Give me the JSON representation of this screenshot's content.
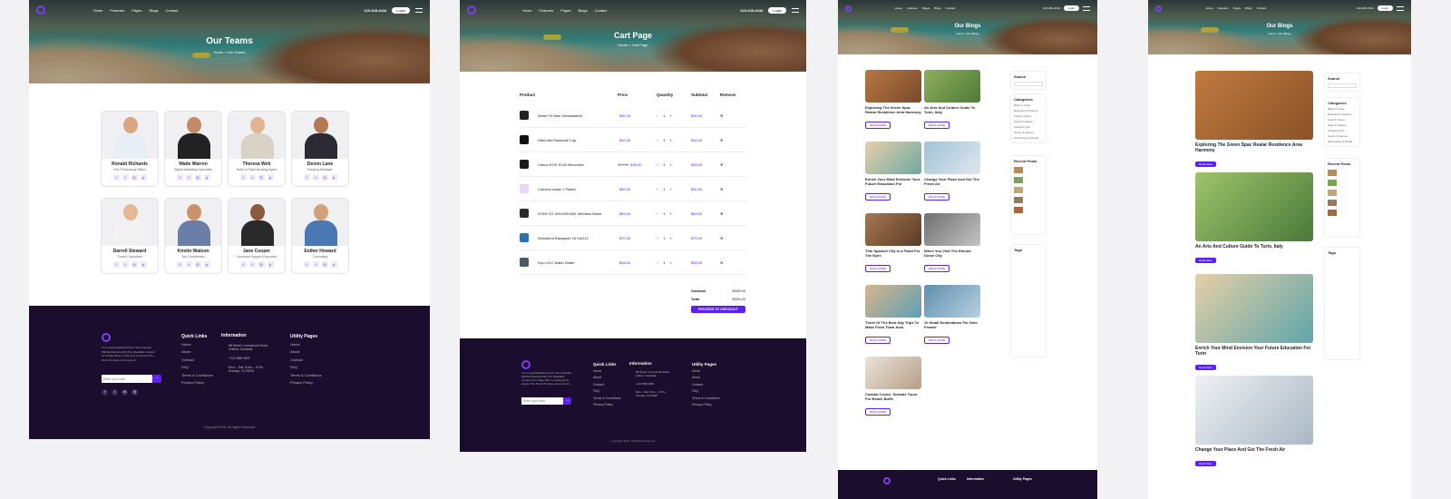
{
  "nav": {
    "links": [
      "Home",
      "Features",
      "Pages",
      "Blogs",
      "Contact"
    ],
    "call_label": "Call Us",
    "phone": "123-345-4444",
    "login": "Login"
  },
  "team_page": {
    "title": "Our Teams",
    "breadcrumb": "Home > Our Teams",
    "members": [
      {
        "name": "Ronald Richards",
        "role": "Vice Processing Officer"
      },
      {
        "name": "Wade Warren",
        "role": "Digital Marketing Specialist"
      },
      {
        "name": "Theresa Web",
        "role": "Hotel & Flight Booking Agent"
      },
      {
        "name": "Devon Lane",
        "role": "Booking Manager"
      },
      {
        "name": "Darrell Steward",
        "role": "Travel Consultant"
      },
      {
        "name": "Kristin Watson",
        "role": "Tour Coordinator"
      },
      {
        "name": "Jane Cooper",
        "role": "Customer Support Executive"
      },
      {
        "name": "Esther Howard",
        "role": "Consulting"
      }
    ]
  },
  "cart_page": {
    "title": "Cart Page",
    "breadcrumb": "Home > Cart Page",
    "columns": [
      "Product",
      "Price",
      "Quantity",
      "Subtotal",
      "Remove"
    ],
    "rows": [
      {
        "product": "Noise Fit Halo Smartwatchs",
        "price": "$30.00",
        "old_price": "",
        "qty": "1",
        "subtotal": "$30.00"
      },
      {
        "product": "Hats Men Baseball Cap",
        "price": "$30.00",
        "old_price": "",
        "qty": "1",
        "subtotal": "$30.00"
      },
      {
        "product": "Canon EOS R100 Mirrorless",
        "price": "$35.00",
        "old_price": "$40.00",
        "qty": "1",
        "subtotal": "$35.00"
      },
      {
        "product": "Camera Instax 1 Pastel",
        "price": "$50.00",
        "old_price": "",
        "qty": "1",
        "subtotal": "$50.00"
      },
      {
        "product": "SONY EX WH1000XM4 Wireless Noise",
        "price": "$69.00",
        "old_price": "",
        "qty": "1",
        "subtotal": "$69.00"
      },
      {
        "product": "Woodland Backpack 18 Hot112",
        "price": "$70.00",
        "old_price": "",
        "qty": "1",
        "subtotal": "$70.00"
      },
      {
        "product": "Kiyo UVC Water Bottle",
        "price": "$55.00",
        "old_price": "",
        "qty": "1",
        "subtotal": "$55.00"
      }
    ],
    "subtotal_label": "Subtotal",
    "subtotal": "$339.00",
    "total_label": "Total",
    "total": "$339.00",
    "checkout": "PROCEED TO CHECKOUT"
  },
  "blog_grid": {
    "title": "Our Blogs",
    "breadcrumb": "Home > Our Blogs",
    "posts": [
      {
        "title": "Exploring The Green Spac Realar Residence Area Harmony"
      },
      {
        "title": "An Arts And Culture Guide To Turin, Italy"
      },
      {
        "title": "Enrich Your Mind Envision Your Future Education For"
      },
      {
        "title": "Change Your Place And Get The Fresh Air"
      },
      {
        "title": "This Spanish City Is a Feast For The Eyes"
      },
      {
        "title": "When You Visit The Eternal Dome City"
      },
      {
        "title": "Three Of The Best Day Trips To Make From Town Area"
      },
      {
        "title": "10 Small Destinations For Solo Female"
      },
      {
        "title": "Coastal Cruise: Seaside Tours For Beach Buffs"
      }
    ],
    "read_more": "READ MORE",
    "sidebar": {
      "search": "Search",
      "categories_title": "Categories",
      "categories": [
        "Bicke & Cube",
        "Business & Finance",
        "Food & Travel",
        "Style & Fashion",
        "Lifestyle & Art",
        "Sports & Games",
        "Technology & Media"
      ],
      "recent_title": "Recent Posts",
      "tags_title": "Tags"
    }
  },
  "blog_list": {
    "title": "Our Blogs",
    "breadcrumb": "Home > Our Blogs",
    "posts": [
      {
        "title": "Exploring The Green Spac Realar Residence Area Harmony"
      },
      {
        "title": "An Arts And Culture Guide To Turin, Italy"
      },
      {
        "title": "Enrich Your Mind Envision Your Future Education For Turin"
      },
      {
        "title": "Change Your Place And Get The Fresh Air"
      }
    ],
    "read_more": "Read More"
  },
  "footer": {
    "about": "It Is Long Established Fact That A Reader Will Be Distracted By The Readable Content Of A Page When Looking At Its Layout The Point Of Using Lorem Ipsum",
    "email_placeholder": "Enter your mail",
    "quick_title": "Quick Links",
    "quick_links": [
      "Home",
      "About",
      "Contact",
      "FAQ",
      "Terms & Conditions",
      "Privacy Policy"
    ],
    "info_title": "Information",
    "address": "58 Street Commercial Road Fratton, Australia",
    "phone": "+123 888 9999",
    "hours": "Mon – Sat: 8 Am – 5 Pm, Sunday: CLOSED",
    "utility_title": "Utility Pages",
    "utility_links": [
      "Home",
      "About",
      "Contact",
      "FAQ",
      "Terms & Conditions",
      "Privacy Policy"
    ],
    "copyright": "Copyright 2025, All Rights Reserved"
  }
}
